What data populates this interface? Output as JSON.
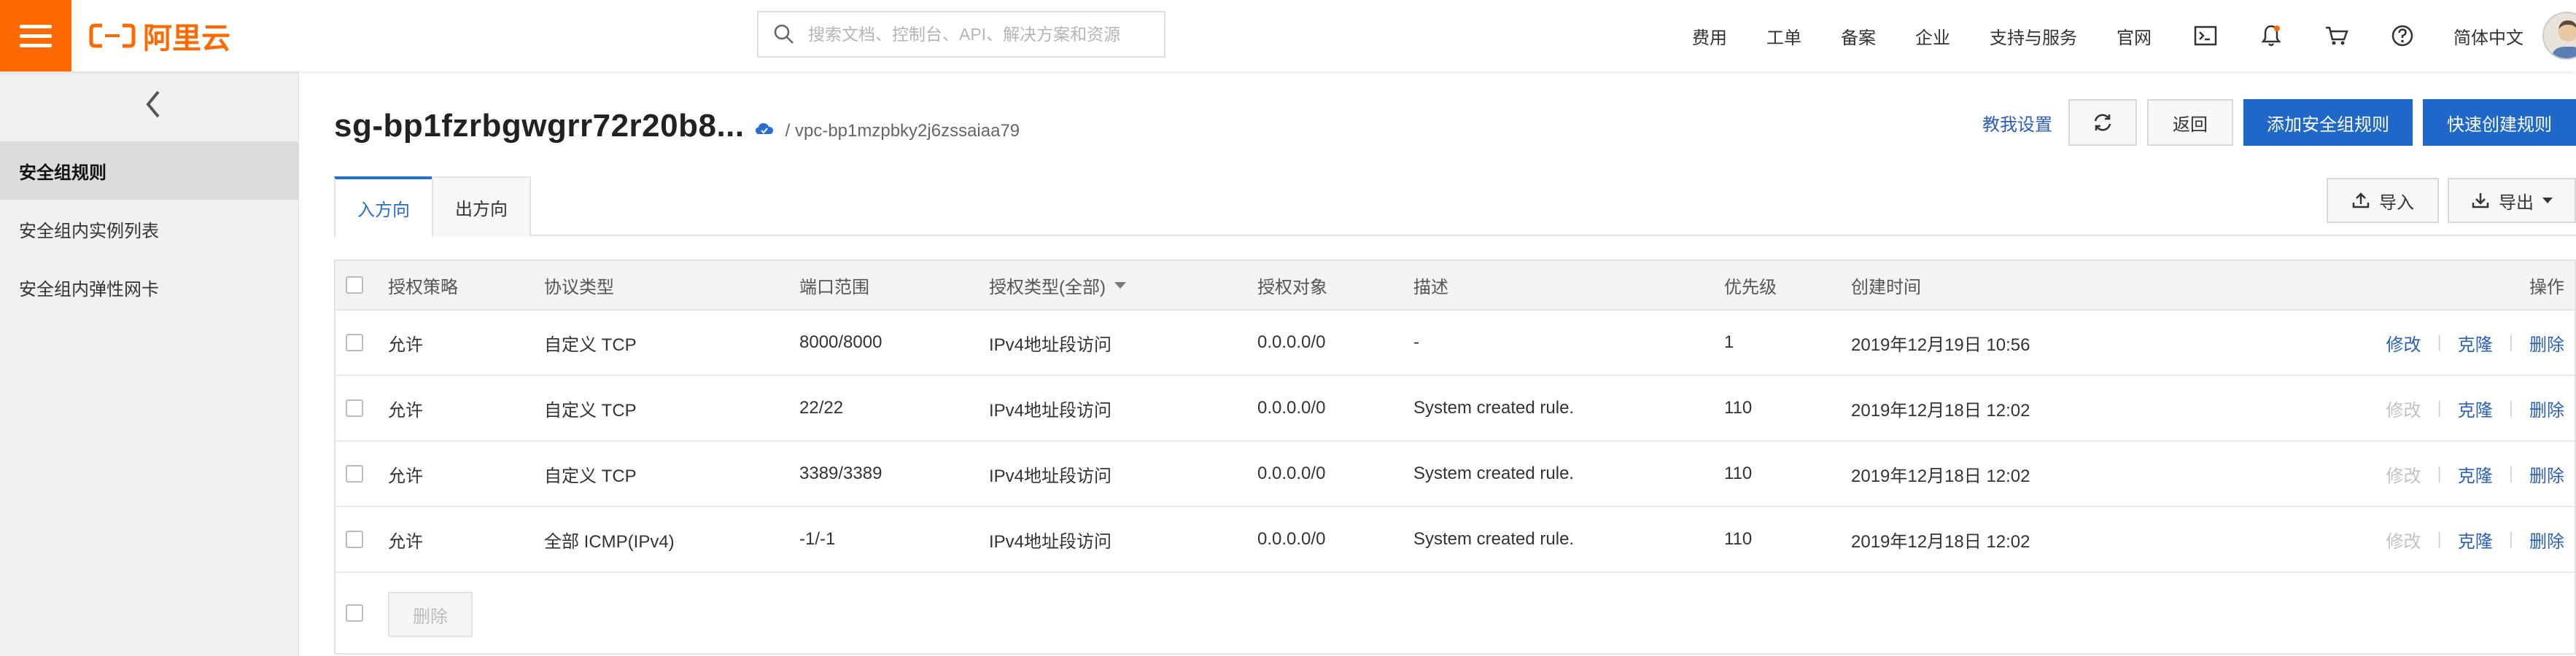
{
  "topbar": {
    "logo_text": "阿里云",
    "search_placeholder": "搜索文档、控制台、API、解决方案和资源",
    "nav": [
      "费用",
      "工单",
      "备案",
      "企业",
      "支持与服务",
      "官网"
    ],
    "icons": [
      "terminal-icon",
      "bell-icon",
      "cart-icon",
      "help-icon"
    ],
    "language": "简体中文",
    "brand_color": "#ff6a00"
  },
  "sidebar": {
    "items": [
      {
        "label": "安全组规则",
        "active": true
      },
      {
        "label": "安全组内实例列表",
        "active": false
      },
      {
        "label": "安全组内弹性网卡",
        "active": false
      }
    ]
  },
  "header": {
    "title": "sg-bp1fzrbgwgrr72r20b8...",
    "vpc": "/ vpc-bp1mzpbky2j6zssaiaa79",
    "tutorial_link": "教我设置",
    "back_label": "返回",
    "add_rule_label": "添加安全组规则",
    "quick_create_label": "快速创建规则",
    "accent_color": "#1f67c9"
  },
  "tabs": {
    "inbound": "入方向",
    "outbound": "出方向"
  },
  "tools": {
    "import_label": "导入",
    "export_label": "导出"
  },
  "table": {
    "columns": [
      "授权策略",
      "协议类型",
      "端口范围",
      "授权类型(全部)",
      "授权对象",
      "描述",
      "优先级",
      "创建时间",
      "操作"
    ],
    "rows": [
      {
        "policy": "允许",
        "protocol": "自定义 TCP",
        "port": "8000/8000",
        "auth_type": "IPv4地址段访问",
        "target": "0.0.0.0/0",
        "desc": "-",
        "priority": "1",
        "created": "2019年12月19日 10:56",
        "edit_enabled": true
      },
      {
        "policy": "允许",
        "protocol": "自定义 TCP",
        "port": "22/22",
        "auth_type": "IPv4地址段访问",
        "target": "0.0.0.0/0",
        "desc": "System created rule.",
        "priority": "110",
        "created": "2019年12月18日 12:02",
        "edit_enabled": false
      },
      {
        "policy": "允许",
        "protocol": "自定义 TCP",
        "port": "3389/3389",
        "auth_type": "IPv4地址段访问",
        "target": "0.0.0.0/0",
        "desc": "System created rule.",
        "priority": "110",
        "created": "2019年12月18日 12:02",
        "edit_enabled": false
      },
      {
        "policy": "允许",
        "protocol": "全部 ICMP(IPv4)",
        "port": "-1/-1",
        "auth_type": "IPv4地址段访问",
        "target": "0.0.0.0/0",
        "desc": "System created rule.",
        "priority": "110",
        "created": "2019年12月18日 12:02",
        "edit_enabled": false
      }
    ],
    "actions": {
      "edit": "修改",
      "clone": "克隆",
      "delete": "删除"
    },
    "bulk_delete_label": "删除"
  }
}
